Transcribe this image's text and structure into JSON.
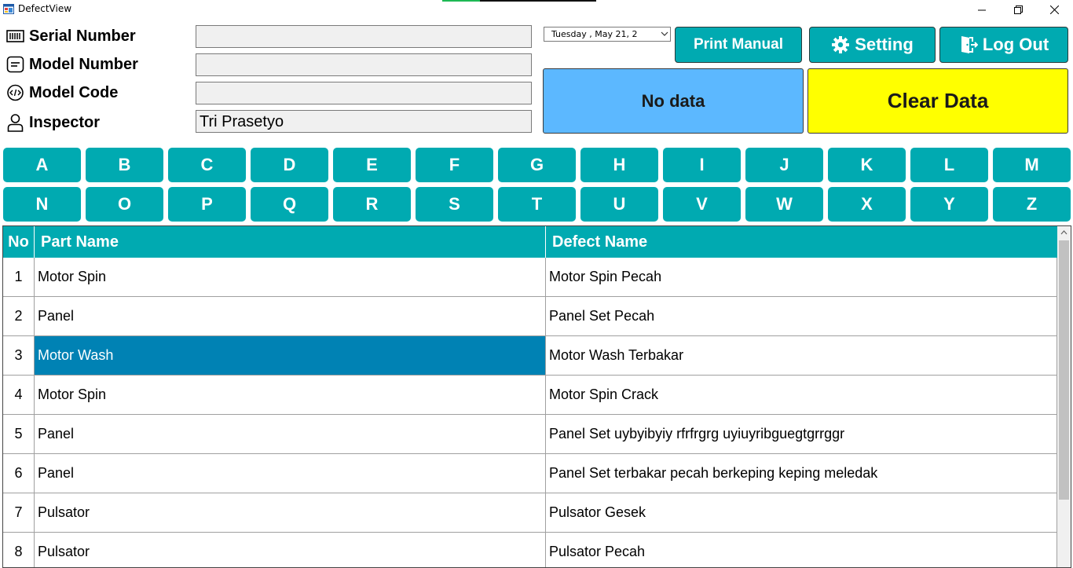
{
  "window": {
    "title": "DefectView",
    "controls": {
      "minimize_icon": "minimize-icon",
      "restore_icon": "restore-icon",
      "close_icon": "close-icon"
    }
  },
  "fields": {
    "serial_number": {
      "label": "Serial Number",
      "value": "",
      "icon": "barcode-icon"
    },
    "model_number": {
      "label": "Model Number",
      "value": "",
      "icon": "document-icon"
    },
    "model_code": {
      "label": "Model Code",
      "value": "",
      "icon": "code-icon"
    },
    "inspector": {
      "label": "Inspector",
      "value": "Tri Prasetyo",
      "icon": "user-icon"
    }
  },
  "date_picker": {
    "value": "Tuesday ,     May      21, 2"
  },
  "buttons": {
    "print_manual": "Print Manual",
    "setting": "Setting",
    "log_out": "Log Out",
    "status": "No data",
    "clear_data": "Clear Data"
  },
  "letters": [
    "A",
    "B",
    "C",
    "D",
    "E",
    "F",
    "G",
    "H",
    "I",
    "J",
    "K",
    "L",
    "M",
    "N",
    "O",
    "P",
    "Q",
    "R",
    "S",
    "T",
    "U",
    "V",
    "W",
    "X",
    "Y",
    "Z"
  ],
  "grid": {
    "columns": [
      "No",
      "Part Name",
      "Defect Name"
    ],
    "rows": [
      {
        "no": "1",
        "part": "Motor Spin",
        "defect": "Motor Spin Pecah"
      },
      {
        "no": "2",
        "part": "Panel",
        "defect": "Panel Set Pecah"
      },
      {
        "no": "3",
        "part": "Motor Wash",
        "defect": "Motor Wash Terbakar"
      },
      {
        "no": "4",
        "part": "Motor Spin",
        "defect": "Motor Spin Crack"
      },
      {
        "no": "5",
        "part": "Panel",
        "defect": "Panel Set uybyibyiy  rfrfrgrg uyiuyribguegtgrrggr"
      },
      {
        "no": "6",
        "part": "Panel",
        "defect": "Panel Set terbakar pecah berkeping keping meledak"
      },
      {
        "no": "7",
        "part": "Pulsator",
        "defect": "Pulsator Gesek"
      },
      {
        "no": "8",
        "part": "Pulsator",
        "defect": "Pulsator Pecah"
      }
    ],
    "selected_row": 2
  },
  "colors": {
    "teal": "#00aab1",
    "status_blue": "#5cb8ff",
    "clear_yellow": "#ffff00",
    "selection": "#0082b4"
  }
}
